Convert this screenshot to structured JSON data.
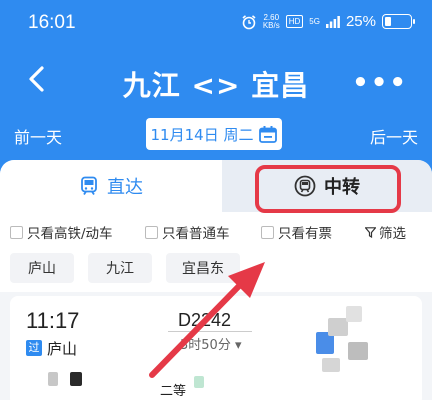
{
  "status_bar": {
    "time": "16:01",
    "net_rate_value": "2.60",
    "net_rate_unit": "KB/s",
    "hd_badge": "HD",
    "network": "5G",
    "battery": "25%",
    "battery_level": 0.25
  },
  "header": {
    "title": "九江 <> 宜昌",
    "back_icon": "chevron-left-icon",
    "more_icon": "more-horizontal-icon"
  },
  "date_bar": {
    "prev_label": "前一天",
    "date_label": "11月14日 周二",
    "next_label": "后一天",
    "calendar_icon": "calendar-icon"
  },
  "tabs": {
    "direct_label": "直达",
    "direct_icon": "train-icon",
    "transfer_label": "中转",
    "transfer_icon": "transfer-icon"
  },
  "filters": {
    "high_speed": "只看高铁/动车",
    "normal": "只看普通车",
    "has_ticket": "只看有票",
    "sift": "筛选"
  },
  "stations": [
    "庐山",
    "九江",
    "宜昌东"
  ],
  "train_card": {
    "dep_time": "11:17",
    "pass_tag": "过",
    "dep_station": "庐山",
    "train_no": "D2242",
    "duration": "3时50分",
    "seat_class": "二等"
  },
  "colors": {
    "primary": "#2f8bf0",
    "highlight": "#e53947"
  }
}
